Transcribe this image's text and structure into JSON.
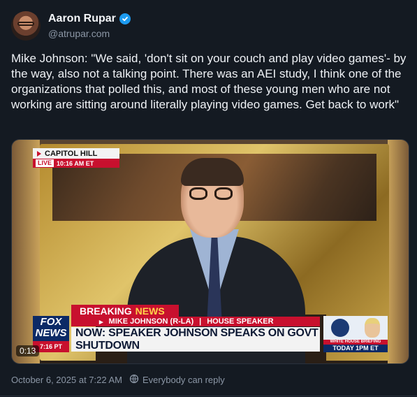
{
  "author": {
    "display_name": "Aaron Rupar",
    "handle": "@atrupar.com",
    "verified_icon": "verified-badge-icon"
  },
  "post": {
    "text": "Mike Johnson: \"We said, 'don't sit on your couch and play video games'- by the way, also not a talking point. There was an AEI study, I think one of the organizations that polled this, and most of these young men who are not working are sitting around literally playing video games. Get back to work\""
  },
  "video": {
    "duration": "0:13",
    "overlay": {
      "place": "CAPITOL HILL",
      "live": "LIVE",
      "live_time": "10:16 AM ET",
      "breaking": "BREAKING",
      "breaking_news": "NEWS",
      "name_line": "MIKE JOHNSON (R-LA)",
      "title_line": "HOUSE SPEAKER",
      "headline": "NOW: SPEAKER JOHNSON SPEAKS ON GOVT SHUTDOWN",
      "logo_top": "FOX",
      "logo_bottom": "NEWS",
      "logo_time": "7:16 PT",
      "wh_label": "WHITE HOUSE BRIEFING",
      "wh_time": "TODAY 1PM ET"
    }
  },
  "footer": {
    "date": "October 6, 2025 at 7:22 AM",
    "reply_setting": "Everybody can reply"
  },
  "colors": {
    "background": "#141a22",
    "accent": "#1d9bf0",
    "fox_red": "#c8102e",
    "fox_blue": "#0c2a66"
  }
}
